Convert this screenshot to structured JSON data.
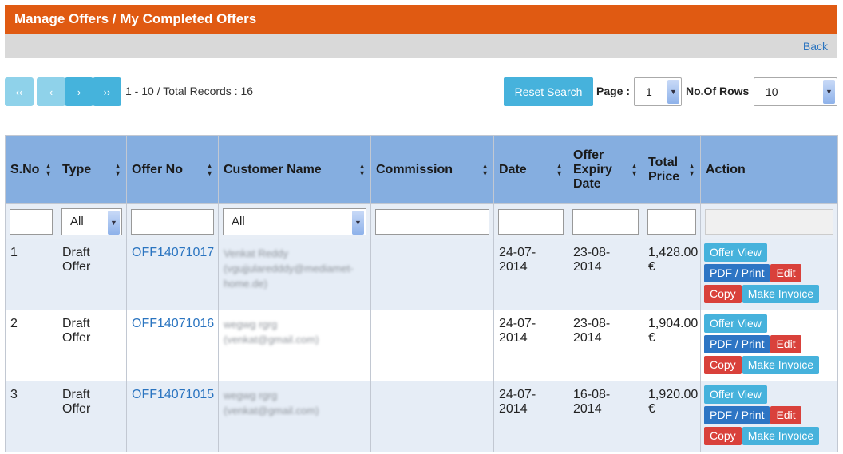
{
  "header": {
    "title": "Manage Offers / My Completed Offers",
    "back_label": "Back"
  },
  "pager": {
    "first": "‹‹",
    "prev": "‹",
    "next": "›",
    "last": "››",
    "records_text": "1 - 10 / Total Records : 16",
    "reset_label": "Reset Search",
    "page_label": "Page :",
    "page_value": "1",
    "rows_label": "No.Of Rows",
    "rows_value": "10"
  },
  "table": {
    "columns": [
      "S.No",
      "Type",
      "Offer No",
      "Customer Name",
      "Commission",
      "Date",
      "Offer Expiry Date",
      "Total Price",
      "Action"
    ],
    "filters": {
      "type_value": "All",
      "customer_value": "All"
    },
    "actions": {
      "view": "Offer View",
      "pdf": "PDF / Print",
      "edit": "Edit",
      "copy": "Copy",
      "invoice": "Make Invoice"
    },
    "rows": [
      {
        "sno": "1",
        "type": "Draft Offer",
        "offer_no": "OFF14071017",
        "customer": "Venkat Reddy (vgujjularedddy@mediamet-home.de)",
        "commission": "",
        "date": "24-07-2014",
        "expiry": "23-08-2014",
        "price": "1,428.00 €"
      },
      {
        "sno": "2",
        "type": "Draft Offer",
        "offer_no": "OFF14071016",
        "customer": "wegwg rgrg (venkat@gmail.com)",
        "commission": "",
        "date": "24-07-2014",
        "expiry": "23-08-2014",
        "price": "1,904.00 €"
      },
      {
        "sno": "3",
        "type": "Draft Offer",
        "offer_no": "OFF14071015",
        "customer": "wegwg rgrg (venkat@gmail.com)",
        "commission": "",
        "date": "24-07-2014",
        "expiry": "16-08-2014",
        "price": "1,920.00 €"
      }
    ]
  },
  "colors": {
    "header": "#e05a12",
    "table_head": "#85aee0",
    "info": "#46b2dc",
    "primary": "#2d75c4",
    "danger": "#d9413b"
  }
}
